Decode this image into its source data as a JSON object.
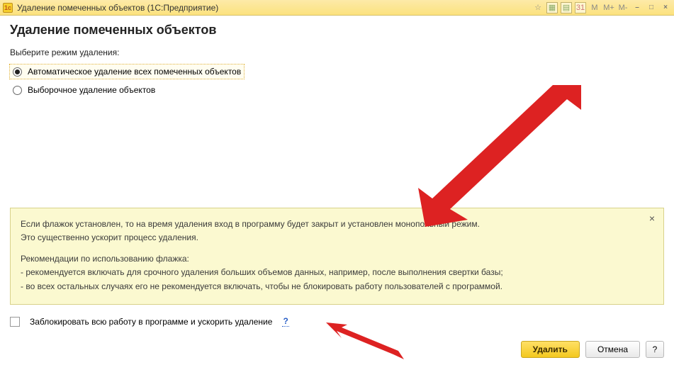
{
  "window": {
    "title": "Удаление помеченных объектов  (1С:Предприятие)"
  },
  "toolbar_icons": {
    "star": "☆",
    "grid": "▦",
    "calc": "▤",
    "cal": "31",
    "m": "M",
    "mplus": "M+",
    "mminus": "M-",
    "min": "–",
    "max": "□",
    "close": "×"
  },
  "heading": "Удаление помеченных объектов",
  "mode_label": "Выберите режим удаления:",
  "radios": {
    "auto": "Автоматическое удаление всех помеченных объектов",
    "selective": "Выборочное удаление объектов"
  },
  "hint": {
    "line1": "Если флажок установлен, то на время удаления вход в программу будет закрыт и установлен монопольный режим.",
    "line2": "Это существенно ускорит процесс удаления.",
    "line3": "Рекомендации по использованию флажка:",
    "line4": "- рекомендуется включать для срочного удаления больших объемов данных, например, после выполнения свертки базы;",
    "line5": "- во всех остальных случаях его не рекомендуется включать, чтобы не блокировать работу пользователей с программой."
  },
  "checkbox_label": "Заблокировать всю работу в программе и ускорить удаление",
  "help_q": "?",
  "buttons": {
    "delete": "Удалить",
    "cancel": "Отмена",
    "help": "?"
  }
}
